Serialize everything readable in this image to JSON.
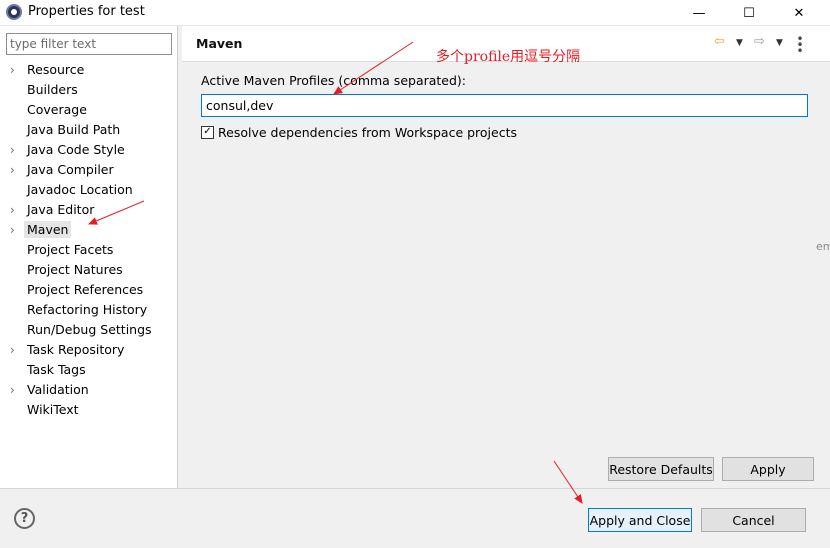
{
  "window": {
    "title": "Properties for test",
    "minimize_glyph": "—",
    "maximize_glyph": "☐",
    "close_glyph": "✕"
  },
  "filter": {
    "placeholder": "type filter text",
    "value": ""
  },
  "tree": {
    "items": [
      {
        "label": "Resource",
        "expandable": true
      },
      {
        "label": "Builders",
        "expandable": false
      },
      {
        "label": "Coverage",
        "expandable": false
      },
      {
        "label": "Java Build Path",
        "expandable": false
      },
      {
        "label": "Java Code Style",
        "expandable": true
      },
      {
        "label": "Java Compiler",
        "expandable": true
      },
      {
        "label": "Javadoc Location",
        "expandable": false
      },
      {
        "label": "Java Editor",
        "expandable": true
      },
      {
        "label": "Maven",
        "expandable": true,
        "selected": true
      },
      {
        "label": "Project Facets",
        "expandable": false
      },
      {
        "label": "Project Natures",
        "expandable": false
      },
      {
        "label": "Project References",
        "expandable": false
      },
      {
        "label": "Refactoring History",
        "expandable": false
      },
      {
        "label": "Run/Debug Settings",
        "expandable": false
      },
      {
        "label": "Task Repository",
        "expandable": true
      },
      {
        "label": "Task Tags",
        "expandable": false
      },
      {
        "label": "Validation",
        "expandable": true
      },
      {
        "label": "WikiText",
        "expandable": false
      }
    ]
  },
  "page": {
    "title": "Maven",
    "profiles_label": "Active Maven Profiles (comma separated):",
    "profiles_value": "consul,dev",
    "resolve_label": "Resolve dependencies from Workspace projects",
    "resolve_checked": true,
    "restore_defaults_label": "Restore Defaults",
    "apply_label": "Apply",
    "edge_text": "em"
  },
  "footer": {
    "apply_close_label": "Apply and Close",
    "cancel_label": "Cancel"
  },
  "annotation": {
    "text": "多个profile用逗号分隔",
    "color": "#e51c23"
  },
  "icons": {
    "back": "back-arrow-icon",
    "forward": "forward-arrow-icon",
    "menu": "view-menu-icon",
    "help": "help-icon"
  }
}
